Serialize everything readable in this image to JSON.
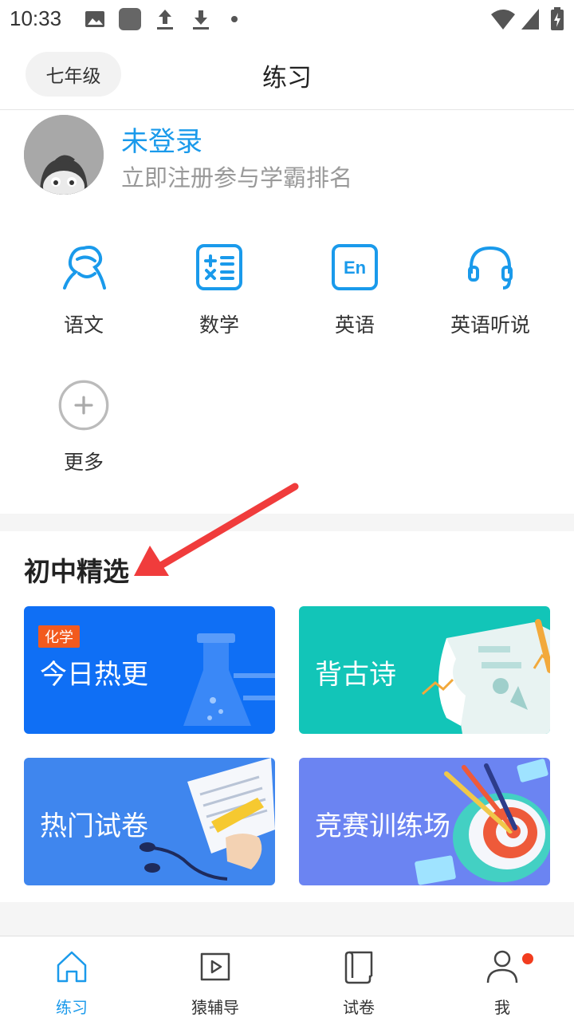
{
  "status_bar": {
    "time": "10:33"
  },
  "header": {
    "grade": "七年级",
    "title": "练习"
  },
  "profile": {
    "name": "未登录",
    "hint": "立即注册参与学霸排名"
  },
  "subjects": [
    {
      "label": "语文",
      "icon": "literature-icon"
    },
    {
      "label": "数学",
      "icon": "math-icon"
    },
    {
      "label": "英语",
      "icon": "english-icon",
      "icon_text": "En"
    },
    {
      "label": "英语听说",
      "icon": "headphones-icon"
    },
    {
      "label": "更多",
      "icon": "plus-circle-icon"
    }
  ],
  "section": {
    "title": "初中精选"
  },
  "cards": [
    {
      "label": "今日热更",
      "tag": "化学",
      "color": "#0f6ff5"
    },
    {
      "label": "背古诗",
      "color": "#12c5b8"
    },
    {
      "label": "热门试卷",
      "color": "#3f86ee"
    },
    {
      "label": "竞赛训练场",
      "color": "#6b84f2"
    }
  ],
  "nav": [
    {
      "label": "练习",
      "icon": "home-icon",
      "active": true
    },
    {
      "label": "猿辅导",
      "icon": "video-play-icon"
    },
    {
      "label": "试卷",
      "icon": "paper-scroll-icon"
    },
    {
      "label": "我",
      "icon": "user-icon"
    }
  ],
  "colors": {
    "accent": "#1a9aeb",
    "notification": "#f23c1e",
    "annotation_arrow": "#f03c3c"
  }
}
